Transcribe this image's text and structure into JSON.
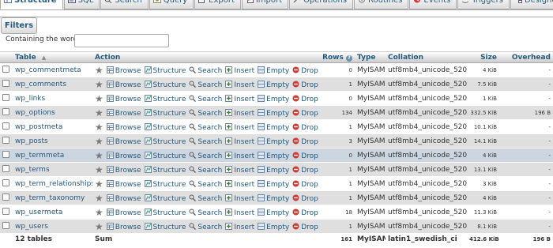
{
  "tabs": [
    {
      "label": "Structure",
      "icon": "table-structure-icon",
      "active": true
    },
    {
      "label": "SQL",
      "icon": "sql-icon"
    },
    {
      "label": "Search",
      "icon": "search-icon"
    },
    {
      "label": "Query",
      "icon": "query-icon"
    },
    {
      "label": "Export",
      "icon": "export-icon"
    },
    {
      "label": "Import",
      "icon": "import-icon"
    },
    {
      "label": "Operations",
      "icon": "operations-icon"
    },
    {
      "label": "Routines",
      "icon": "routines-icon"
    },
    {
      "label": "Events",
      "icon": "events-icon"
    },
    {
      "label": "Triggers",
      "icon": "triggers-icon"
    },
    {
      "label": "Designer",
      "icon": "designer-icon"
    }
  ],
  "filters": {
    "legend": "Filters",
    "label": "Containing the word:",
    "value": ""
  },
  "columns": {
    "table": "Table",
    "sort_arrow": "▲",
    "action": "Action",
    "rows": "Rows",
    "rows_help": "?",
    "type": "Type",
    "collation": "Collation",
    "size": "Size",
    "overhead": "Overhead"
  },
  "actions": {
    "browse": "Browse",
    "structure": "Structure",
    "search": "Search",
    "insert": "Insert",
    "empty": "Empty",
    "drop": "Drop"
  },
  "tables": [
    {
      "name": "wp_commentmeta",
      "rows": "0",
      "type": "MyISAM",
      "collation": "utf8mb4_unicode_520_ci",
      "size": "4 KiB",
      "overhead": "-"
    },
    {
      "name": "wp_comments",
      "rows": "1",
      "type": "MyISAM",
      "collation": "utf8mb4_unicode_520_ci",
      "size": "7.5 KiB",
      "overhead": "-"
    },
    {
      "name": "wp_links",
      "rows": "0",
      "type": "MyISAM",
      "collation": "utf8mb4_unicode_520_ci",
      "size": "1 KiB",
      "overhead": "-"
    },
    {
      "name": "wp_options",
      "rows": "134",
      "type": "MyISAM",
      "collation": "utf8mb4_unicode_520_ci",
      "size": "332.5 KiB",
      "overhead": "196 B"
    },
    {
      "name": "wp_postmeta",
      "rows": "1",
      "type": "MyISAM",
      "collation": "utf8mb4_unicode_520_ci",
      "size": "10.1 KiB",
      "overhead": "-"
    },
    {
      "name": "wp_posts",
      "rows": "3",
      "type": "MyISAM",
      "collation": "utf8mb4_unicode_520_ci",
      "size": "14.1 KiB",
      "overhead": "-"
    },
    {
      "name": "wp_termmeta",
      "rows": "0",
      "type": "MyISAM",
      "collation": "utf8mb4_unicode_520_ci",
      "size": "4 KiB",
      "overhead": "-"
    },
    {
      "name": "wp_terms",
      "rows": "1",
      "type": "MyISAM",
      "collation": "utf8mb4_unicode_520_ci",
      "size": "13.1 KiB",
      "overhead": "-"
    },
    {
      "name": "wp_term_relationships",
      "rows": "1",
      "type": "MyISAM",
      "collation": "utf8mb4_unicode_520_ci",
      "size": "3 KiB",
      "overhead": "-"
    },
    {
      "name": "wp_term_taxonomy",
      "rows": "1",
      "type": "MyISAM",
      "collation": "utf8mb4_unicode_520_ci",
      "size": "4 KiB",
      "overhead": "-"
    },
    {
      "name": "wp_usermeta",
      "rows": "18",
      "type": "MyISAM",
      "collation": "utf8mb4_unicode_520_ci",
      "size": "11.3 KiB",
      "overhead": "-"
    },
    {
      "name": "wp_users",
      "rows": "1",
      "type": "MyISAM",
      "collation": "utf8mb4_unicode_520_ci",
      "size": "8.1 KiB",
      "overhead": "-"
    }
  ],
  "highlighted_row": 6,
  "summary": {
    "count": "12 tables",
    "label": "Sum",
    "rows": "161",
    "type": "MyISAM",
    "collation": "latin1_swedish_ci",
    "size": "412.6 KiB",
    "overhead": "196 B"
  },
  "colors": {
    "link": "#235a81",
    "row_even": "#dfdfdf",
    "row_highlight": "#ccd6e0",
    "drop_red": "#d43a2f"
  }
}
